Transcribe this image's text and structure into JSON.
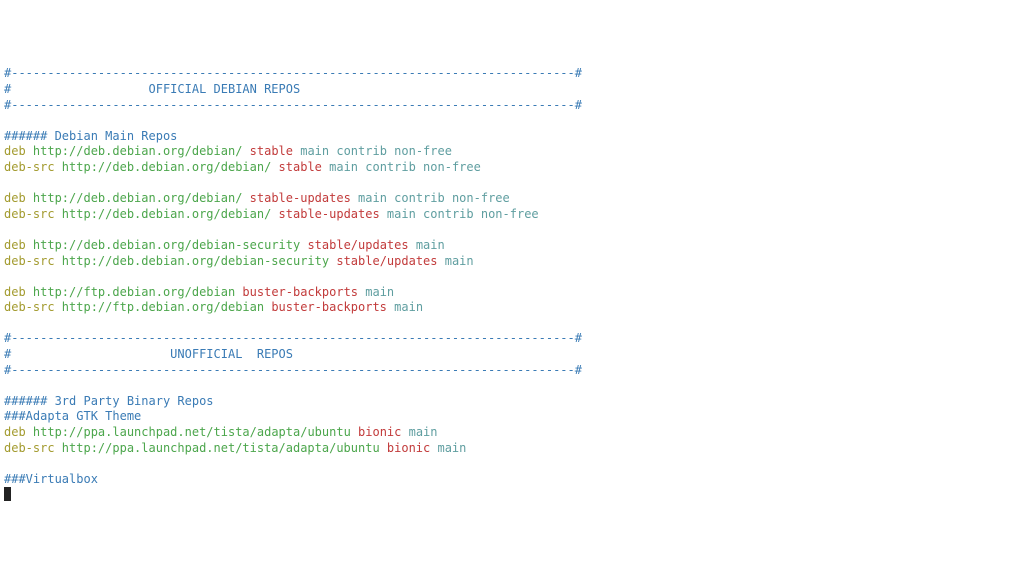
{
  "lines": [
    [
      {
        "c": "blue",
        "t": "#------------------------------------------------------------------------------#"
      }
    ],
    [
      {
        "c": "blue",
        "t": "#                   OFFICIAL DEBIAN REPOS                    "
      }
    ],
    [
      {
        "c": "blue",
        "t": "#------------------------------------------------------------------------------#"
      }
    ],
    [],
    [
      {
        "c": "blue",
        "t": "###### "
      },
      {
        "c": "blue",
        "t": "Debian Main Repos"
      }
    ],
    [
      {
        "c": "olive",
        "t": "deb "
      },
      {
        "c": "green",
        "t": "http://deb.debian.org/debian/ "
      },
      {
        "c": "red",
        "t": "stable "
      },
      {
        "c": "teal",
        "t": "main contrib non-free"
      }
    ],
    [
      {
        "c": "olive",
        "t": "deb-src "
      },
      {
        "c": "green",
        "t": "http://deb.debian.org/debian/ "
      },
      {
        "c": "red",
        "t": "stable "
      },
      {
        "c": "teal",
        "t": "main contrib non-free"
      }
    ],
    [],
    [
      {
        "c": "olive",
        "t": "deb "
      },
      {
        "c": "green",
        "t": "http://deb.debian.org/debian/ "
      },
      {
        "c": "red",
        "t": "stable-updates "
      },
      {
        "c": "teal",
        "t": "main contrib non-free"
      }
    ],
    [
      {
        "c": "olive",
        "t": "deb-src "
      },
      {
        "c": "green",
        "t": "http://deb.debian.org/debian/ "
      },
      {
        "c": "red",
        "t": "stable-updates "
      },
      {
        "c": "teal",
        "t": "main contrib non-free"
      }
    ],
    [],
    [
      {
        "c": "olive",
        "t": "deb "
      },
      {
        "c": "green",
        "t": "http://deb.debian.org/debian-security "
      },
      {
        "c": "red",
        "t": "stable/updates "
      },
      {
        "c": "teal",
        "t": "main"
      }
    ],
    [
      {
        "c": "olive",
        "t": "deb-src "
      },
      {
        "c": "green",
        "t": "http://deb.debian.org/debian-security "
      },
      {
        "c": "red",
        "t": "stable/updates "
      },
      {
        "c": "teal",
        "t": "main"
      }
    ],
    [],
    [
      {
        "c": "olive",
        "t": "deb "
      },
      {
        "c": "green",
        "t": "http://ftp.debian.org/debian "
      },
      {
        "c": "red",
        "t": "buster-backports "
      },
      {
        "c": "teal",
        "t": "main"
      }
    ],
    [
      {
        "c": "olive",
        "t": "deb-src "
      },
      {
        "c": "green",
        "t": "http://ftp.debian.org/debian "
      },
      {
        "c": "red",
        "t": "buster-backports "
      },
      {
        "c": "teal",
        "t": "main"
      }
    ],
    [],
    [
      {
        "c": "blue",
        "t": "#------------------------------------------------------------------------------#"
      }
    ],
    [
      {
        "c": "blue",
        "t": "#                      UNOFFICIAL  REPOS                       "
      }
    ],
    [
      {
        "c": "blue",
        "t": "#------------------------------------------------------------------------------#"
      }
    ],
    [],
    [
      {
        "c": "blue",
        "t": "###### 3rd Party Binary Repos"
      }
    ],
    [
      {
        "c": "blue",
        "t": "###Adapta GTK Theme"
      }
    ],
    [
      {
        "c": "olive",
        "t": "deb "
      },
      {
        "c": "green",
        "t": "http://ppa.launchpad.net/tista/adapta/ubuntu "
      },
      {
        "c": "red",
        "t": "bionic "
      },
      {
        "c": "teal",
        "t": "main"
      }
    ],
    [
      {
        "c": "olive",
        "t": "deb-src "
      },
      {
        "c": "green",
        "t": "http://ppa.launchpad.net/tista/adapta/ubuntu "
      },
      {
        "c": "red",
        "t": "bionic "
      },
      {
        "c": "teal",
        "t": "main"
      }
    ],
    [],
    [
      {
        "c": "blue",
        "t": "###Virtualbox"
      }
    ]
  ]
}
